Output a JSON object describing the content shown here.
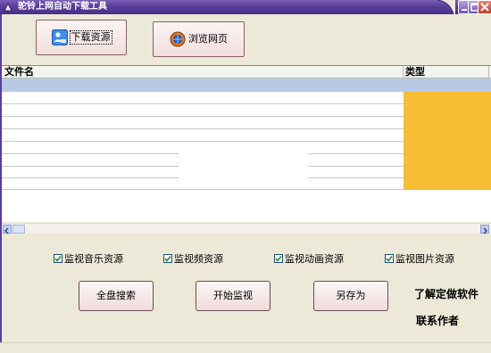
{
  "window": {
    "title": "驼铃上网自动下载工具",
    "controls": [
      "minimize",
      "maximize",
      "close"
    ]
  },
  "toolbar": {
    "download_label": "下载资源",
    "download_icon": "download-user-icon",
    "browse_label": "浏览网页",
    "browse_icon": "globe-icon"
  },
  "file_list": {
    "columns": [
      "文件名",
      "类型"
    ],
    "rows": [],
    "selected_row": 0,
    "type_column_color": "#f6bd35",
    "selection_color": "#b8c9e6"
  },
  "options": {
    "monitor_music": {
      "label": "监视音乐资源",
      "checked": true
    },
    "monitor_video": {
      "label": "监视频资源",
      "checked": true
    },
    "monitor_animation": {
      "label": "监视动画资源",
      "checked": true
    },
    "monitor_images": {
      "label": "监视图片资源",
      "checked": true
    }
  },
  "actions": {
    "full_search": "全盘搜索",
    "start_monitor": "开始监视",
    "save_as": "另存为"
  },
  "links": {
    "about_software": "了解定做软件",
    "contact_author": "联系作者"
  },
  "colors": {
    "titlebar": "#5a3d99",
    "button_face": "#f7e8e8",
    "window_bg": "#ece9d8"
  }
}
